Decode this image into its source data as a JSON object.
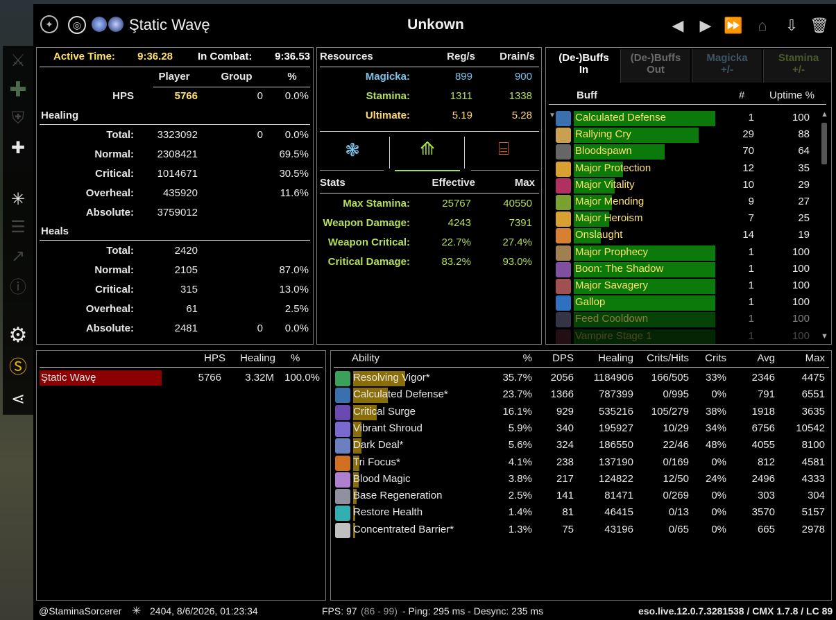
{
  "header": {
    "char_name": "Ştatic Wavę",
    "fight_name": "Unkown"
  },
  "summary": {
    "active_time_label": "Active Time:",
    "active_time": "9:36.28",
    "in_combat_label": "In Combat:",
    "in_combat": "9:36.53",
    "col_player": "Player",
    "col_group": "Group",
    "col_pct": "%",
    "hps_label": "HPS",
    "hps_player": "5766",
    "hps_group": "0",
    "hps_pct": "0.0%",
    "healing_header": "Healing",
    "healing_rows": [
      {
        "label": "Total:",
        "player": "3323092",
        "group": "0",
        "pct": "0.0%"
      },
      {
        "label": "Normal:",
        "player": "2308421",
        "group": "",
        "pct": "69.5%"
      },
      {
        "label": "Critical:",
        "player": "1014671",
        "group": "",
        "pct": "30.5%"
      },
      {
        "label": "Overheal:",
        "player": "435920",
        "group": "",
        "pct": "11.6%"
      },
      {
        "label": "Absolute:",
        "player": "3759012",
        "group": "",
        "pct": ""
      }
    ],
    "heals_header": "Heals",
    "heals_rows": [
      {
        "label": "Total:",
        "player": "2420",
        "group": "",
        "pct": ""
      },
      {
        "label": "Normal:",
        "player": "2105",
        "group": "",
        "pct": "87.0%"
      },
      {
        "label": "Critical:",
        "player": "315",
        "group": "",
        "pct": "13.0%"
      },
      {
        "label": "Overheal:",
        "player": "61",
        "group": "",
        "pct": "2.5%"
      },
      {
        "label": "Absolute:",
        "player": "2481",
        "group": "0",
        "pct": "0.0%"
      }
    ]
  },
  "resources": {
    "title": "Resources",
    "col_reg": "Reg/s",
    "col_drain": "Drain/s",
    "rows": [
      {
        "label": "Magicka:",
        "reg": "899",
        "drain": "900",
        "color": "#7ec3ea"
      },
      {
        "label": "Stamina:",
        "reg": "1311",
        "drain": "1338",
        "color": "#b7df5e"
      },
      {
        "label": "Ultimate:",
        "reg": "5.19",
        "drain": "5.28",
        "color": "#ffd873"
      }
    ],
    "stats_title": "Stats",
    "col_effective": "Effective",
    "col_max": "Max",
    "stats": [
      {
        "label": "Max Stamina:",
        "effective": "25767",
        "max": "40550"
      },
      {
        "label": "Weapon Damage:",
        "effective": "4243",
        "max": "7391"
      },
      {
        "label": "Weapon Critical:",
        "effective": "22.7%",
        "max": "27.4%"
      },
      {
        "label": "Critical Damage:",
        "effective": "83.2%",
        "max": "93.0%"
      }
    ]
  },
  "buffs": {
    "tabs": [
      {
        "l1": "(De-)Buffs",
        "l2": "In"
      },
      {
        "l1": "(De-)Buffs",
        "l2": "Out"
      },
      {
        "l1": "Magicka",
        "l2": "+/-"
      },
      {
        "l1": "Stamina",
        "l2": "+/-"
      }
    ],
    "col_buff": "Buff",
    "col_count": "#",
    "col_uptime": "Uptime %",
    "rows": [
      {
        "name": "Calculated Defense",
        "count": "1",
        "uptime": "100",
        "up": 1.0,
        "color": "#0b7a0b",
        "icon": "#3a6fb0"
      },
      {
        "name": "Rallying Cry",
        "count": "29",
        "uptime": "88",
        "up": 0.88,
        "color": "#0b7a0b",
        "icon": "#c8a050"
      },
      {
        "name": "Bloodspawn",
        "count": "70",
        "uptime": "64",
        "up": 0.64,
        "color": "#0b7a0b",
        "icon": "#666"
      },
      {
        "name": "Major Protection",
        "count": "12",
        "uptime": "35",
        "up": 0.35,
        "color": "#0b7a0b",
        "icon": "#d8a030"
      },
      {
        "name": "Major Vitality",
        "count": "10",
        "uptime": "29",
        "up": 0.29,
        "color": "#0b7a0b",
        "icon": "#b03060"
      },
      {
        "name": "Major Mending",
        "count": "9",
        "uptime": "27",
        "up": 0.27,
        "color": "#0b7a0b",
        "icon": "#7aa030"
      },
      {
        "name": "Major Heroism",
        "count": "7",
        "uptime": "25",
        "up": 0.25,
        "color": "#0b7a0b",
        "icon": "#d8a030"
      },
      {
        "name": "Onslaught",
        "count": "14",
        "uptime": "19",
        "up": 0.19,
        "color": "#0b7a0b",
        "icon": "#d88030"
      },
      {
        "name": "Major Prophecy",
        "count": "1",
        "uptime": "100",
        "up": 1.0,
        "color": "#0b7a0b",
        "icon": "#a08050"
      },
      {
        "name": "Boon: The Shadow",
        "count": "1",
        "uptime": "100",
        "up": 1.0,
        "color": "#0b7a0b",
        "icon": "#8050a0"
      },
      {
        "name": "Major Savagery",
        "count": "1",
        "uptime": "100",
        "up": 1.0,
        "color": "#0b7a0b",
        "icon": "#a05050"
      },
      {
        "name": "Gallop",
        "count": "1",
        "uptime": "100",
        "up": 1.0,
        "color": "#0b7a0b",
        "icon": "#3070c0"
      },
      {
        "name": "Feed Cooldown",
        "count": "1",
        "uptime": "100",
        "up": 1.0,
        "color": "#0b7a0b",
        "icon": "#606080"
      },
      {
        "name": "Vampire Stage 1",
        "count": "1",
        "uptime": "100",
        "up": 1.0,
        "color": "#0b7a0b",
        "icon": "#703040"
      }
    ]
  },
  "units": {
    "col_hps": "HPS",
    "col_healing": "Healing",
    "col_pct": "%",
    "rows": [
      {
        "name": "Ştatic Wavę",
        "hps": "5766",
        "healing": "3.32M",
        "pct": "100.0%",
        "share": 1.0
      }
    ]
  },
  "abilities": {
    "cols": [
      "Ability",
      "%",
      "DPS",
      "Healing",
      "Crits/Hits",
      "Crits",
      "Avg",
      "Max"
    ],
    "rows": [
      {
        "name": "Resolving Vigor*",
        "pct": "35.7%",
        "dps": "2056",
        "healing": "1184906",
        "crits_hits": "166/505",
        "crits": "33%",
        "avg": "2346",
        "max": "4475",
        "share": 0.357,
        "icon": "#3aa05a"
      },
      {
        "name": "Calculated Defense*",
        "pct": "23.7%",
        "dps": "1366",
        "healing": "787399",
        "crits_hits": "0/995",
        "crits": "0%",
        "avg": "791",
        "max": "6551",
        "share": 0.237,
        "icon": "#3a6fb0"
      },
      {
        "name": "Critical Surge",
        "pct": "16.1%",
        "dps": "929",
        "healing": "535216",
        "crits_hits": "105/279",
        "crits": "38%",
        "avg": "1918",
        "max": "3635",
        "share": 0.161,
        "icon": "#6a4ab0"
      },
      {
        "name": "Vibrant Shroud",
        "pct": "5.9%",
        "dps": "340",
        "healing": "195927",
        "crits_hits": "10/29",
        "crits": "34%",
        "avg": "6756",
        "max": "10542",
        "share": 0.059,
        "icon": "#7a6ad0"
      },
      {
        "name": "Dark Deal*",
        "pct": "5.6%",
        "dps": "324",
        "healing": "186550",
        "crits_hits": "22/46",
        "crits": "48%",
        "avg": "4055",
        "max": "8100",
        "share": 0.056,
        "icon": "#6a80c0"
      },
      {
        "name": "Tri Focus*",
        "pct": "4.1%",
        "dps": "238",
        "healing": "137190",
        "crits_hits": "0/169",
        "crits": "0%",
        "avg": "812",
        "max": "4581",
        "share": 0.041,
        "icon": "#d07020"
      },
      {
        "name": "Blood Magic",
        "pct": "3.8%",
        "dps": "217",
        "healing": "124822",
        "crits_hits": "12/50",
        "crits": "24%",
        "avg": "2496",
        "max": "4333",
        "share": 0.038,
        "icon": "#b080d0"
      },
      {
        "name": "Base Regeneration",
        "pct": "2.5%",
        "dps": "141",
        "healing": "81471",
        "crits_hits": "0/269",
        "crits": "0%",
        "avg": "303",
        "max": "304",
        "share": 0.025,
        "icon": "#9090a0"
      },
      {
        "name": "Restore Health",
        "pct": "1.4%",
        "dps": "81",
        "healing": "46415",
        "crits_hits": "0/13",
        "crits": "0%",
        "avg": "3570",
        "max": "5157",
        "share": 0.014,
        "icon": "#30b0b0"
      },
      {
        "name": "Concentrated Barrier*",
        "pct": "1.3%",
        "dps": "75",
        "healing": "43196",
        "crits_hits": "0/65",
        "crits": "0%",
        "avg": "665",
        "max": "2978",
        "share": 0.013,
        "icon": "#c0c0c0"
      }
    ]
  },
  "footer": {
    "account": "@StaminaSorcerer",
    "cp_date": "2404, 8/6/2026, 01:23:34",
    "fps_label": "FPS: 97",
    "fps_range": "(86 - 99)",
    "ping": "- Ping: 295 ms - Desync: 235 ms",
    "version": "eso.live.12.0.7.3281538 / CMX 1.7.8 / LC 89"
  }
}
